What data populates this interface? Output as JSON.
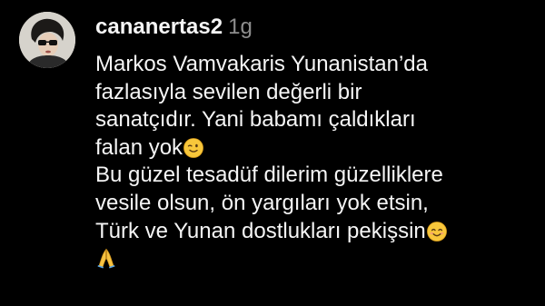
{
  "comment": {
    "username": "cananertas2",
    "timestamp": "1g",
    "lines": [
      "Markos Vamvakaris Yunanistan’da",
      "fazlasıyla sevilen değerli bir",
      "sanatçıdır. Yani babamı çaldıkları",
      "falan yok",
      "Bu güzel tesadüf dilerim güzelliklere",
      "vesile olsun, ön yargıları yok etsin,",
      "Türk ve Yunan dostlukları pekişsin",
      ""
    ],
    "emojis": [
      "winking-face",
      "smiling-face-with-smiling-eyes",
      "folded-hands"
    ]
  },
  "colors": {
    "background": "#000000",
    "text": "#f5f5f5",
    "timestamp": "#8e8e8e"
  }
}
